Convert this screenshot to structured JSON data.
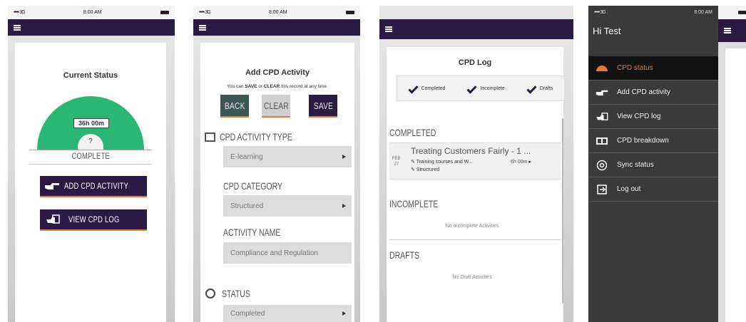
{
  "status_bar": {
    "signal": "••••• 3G",
    "time": "8:00 AM"
  },
  "screen1": {
    "title": "Current Status",
    "gauge_value": "36h 00m",
    "gauge_question": "?",
    "gauge_label": "COMPLETE",
    "add_button": "ADD CPD ACTIVITY",
    "view_button": "VIEW CPD LOG"
  },
  "screen2": {
    "title": "Add CPD Activity",
    "hint_pre": "You can ",
    "hint_save": "SAVE",
    "hint_mid": " or ",
    "hint_clear": "CLEAR",
    "hint_post": " this record at any time.",
    "back_button": "BACK",
    "clear_button": "CLEAR",
    "save_button": "SAVE",
    "activity_type_label": "CPD ACTIVITY TYPE",
    "activity_type_value": "E-learning",
    "category_label": "CPD CATEGORY",
    "category_value": "Structured",
    "activity_name_label": "ACTIVITY NAME",
    "activity_name_value": "Compliance and Regulation",
    "status_label": "STATUS",
    "status_value": "Completed"
  },
  "screen3": {
    "title": "CPD Log",
    "filters": [
      {
        "label": "Completed"
      },
      {
        "label": "Incomplete"
      },
      {
        "label": "Drafts"
      }
    ],
    "completed_heading": "COMPLETED",
    "entry": {
      "month": "FEB",
      "day": "27",
      "title": "Treating Customers Fairly - 1 ...",
      "type": "Training courses and W...",
      "category": "Structured",
      "duration": "6h 00m"
    },
    "incomplete_heading": "INCOMPLETE",
    "incomplete_empty": "No Incomplete Activities",
    "drafts_heading": "DRAFTS",
    "drafts_empty": "No Draft Activities"
  },
  "screen4": {
    "greeting": "Hi Test",
    "menu": [
      {
        "label": "CPD status",
        "active": true
      },
      {
        "label": "Add CPD activity"
      },
      {
        "label": "View CPD log"
      },
      {
        "label": "CPD breakdown"
      },
      {
        "label": "Sync status"
      },
      {
        "label": "Log out"
      }
    ]
  },
  "colors": {
    "brand": "#2c1a45",
    "accent": "#e07a3c",
    "gauge": "#2bb673",
    "menu_bg": "#3a3a3a"
  }
}
